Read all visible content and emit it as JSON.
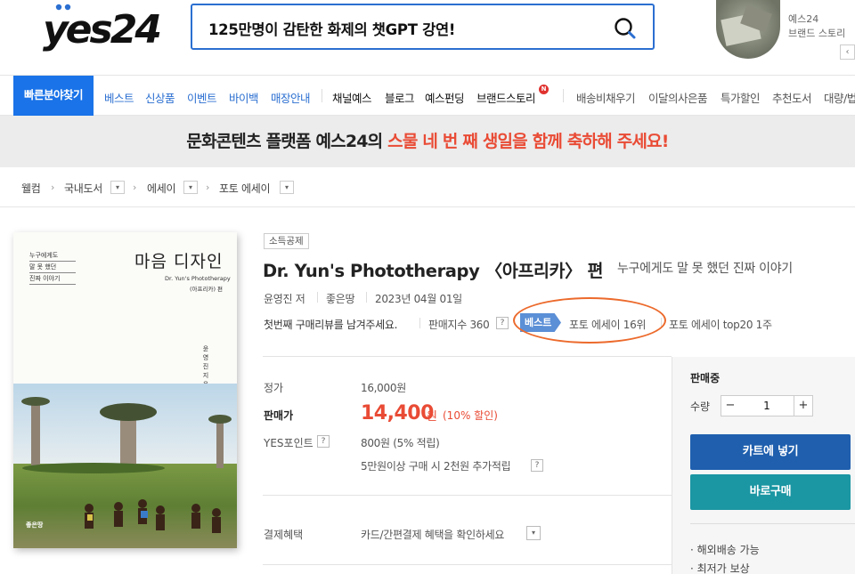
{
  "header": {
    "logo_text": "yes24",
    "search": {
      "value": "125만명이 감탄한 화제의 챗GPT 강연!"
    },
    "brand": {
      "line1": "예스24",
      "line2": "브랜드 스토리",
      "prev": "‹"
    }
  },
  "nav": {
    "category_button": "빠른분야찾기",
    "blue_items": [
      "베스트",
      "신상품",
      "이벤트",
      "바이백",
      "매장안내"
    ],
    "dark_items": [
      "채널예스",
      "블로그",
      "예스펀딩",
      "브랜드스토리"
    ],
    "new_badge": "N",
    "gray_items": [
      "배송비채우기",
      "이달의사은품",
      "특가할인",
      "추천도서",
      "대량/법"
    ]
  },
  "banner": {
    "part1": "문화콘텐츠 플랫폼 예스24의 ",
    "part2": "스물 네 번 째 생일을 함께 축하해 주세요!"
  },
  "breadcrumb": {
    "items": [
      "웰컴",
      "국내도서",
      "에세이",
      "포토 에세이"
    ],
    "arrow": "›",
    "dropdown": "▾"
  },
  "cover": {
    "small_lines": [
      "누구에게도",
      "말 못 했던",
      "진짜 이야기"
    ],
    "title": "마음 디자인",
    "subtitle": "Dr. Yun's Phototherapy",
    "subtitle2": "(아프리카) 편",
    "author": "윤영진 지음",
    "publisher": "좋은땅"
  },
  "product": {
    "tag": "소득공제",
    "title": "Dr. Yun's Phototherapy 〈아프리카〉 편",
    "subtitle": "누구에게도 말 못 했던 진짜 이야기",
    "author": "윤영진 저",
    "publisher": "좋은땅",
    "date": "2023년 04월 01일",
    "review_prompt": "첫번째 구매리뷰를 남겨주세요.",
    "sales_index": "판매지수 360",
    "help": "?",
    "best_badge": "베스트",
    "rank": "포토 에세이 16위",
    "top20": "포토 에세이 top20 1주"
  },
  "price": {
    "list_label": "정가",
    "list_value": "16,000원",
    "sale_label": "판매가",
    "sale_value": "14,400",
    "sale_unit": "원",
    "discount": "(10% 할인)",
    "points_label": "YES포인트",
    "points_value": "800원 (5% 적립)",
    "points_extra": "5만원이상 구매 시 2천원 추가적립",
    "payment_label": "결제혜택",
    "payment_value": "카드/간편결제 혜택을 확인하세요"
  },
  "order": {
    "status": "판매중",
    "qty_label": "수량",
    "qty_value": "1",
    "minus": "−",
    "plus": "+",
    "cart_button": "카트에 넣기",
    "buy_button": "바로구매",
    "notes": [
      "· 해외배송 가능",
      "· 최저가 보상"
    ]
  }
}
